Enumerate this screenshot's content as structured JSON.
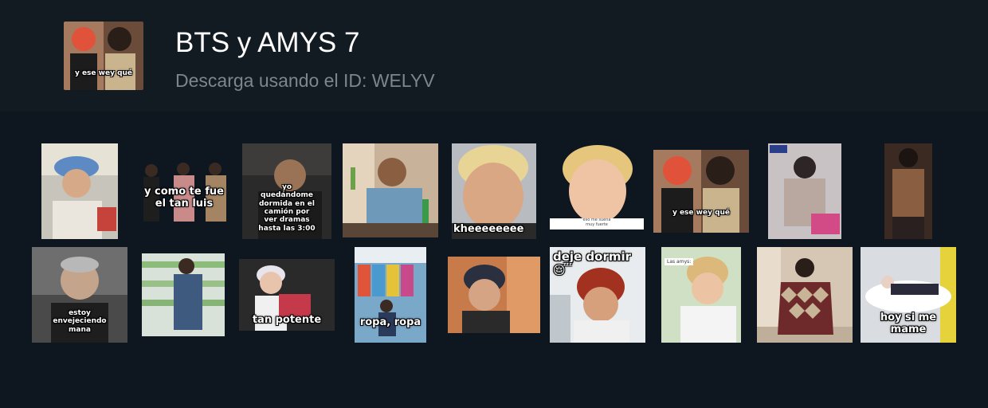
{
  "pack": {
    "title": "BTS y AMYS 7",
    "subtitle": "Descarga usando el ID: WELYV",
    "cover_caption": "y ese wey qué"
  },
  "stickers": {
    "s1": "",
    "s2": "y como te fue\nel tan luis",
    "s3": "yo\nquedándome\ndormida en el\ncamión por\nver dramas\nhasta las 3:00",
    "s4": "",
    "s5": "kheeeeeeee",
    "s6": "eso me suena\nmuy fuerte",
    "s7": "y ese wey qué",
    "s8": "",
    "s9": "",
    "s10": "estoy\nenvejeciendo\nmana",
    "s11": "",
    "s12": "tan potente",
    "s13": "ropa, ropa",
    "s14": "",
    "s15": "deje dormir\n😴",
    "s16_tag": "Las amys:",
    "s16": "",
    "s17": "",
    "s18": "hoy si me\nmame"
  },
  "colors": {
    "background": "#0e1620",
    "header": "#121a22",
    "title": "#ffffff",
    "subtitle": "#7d858d"
  }
}
